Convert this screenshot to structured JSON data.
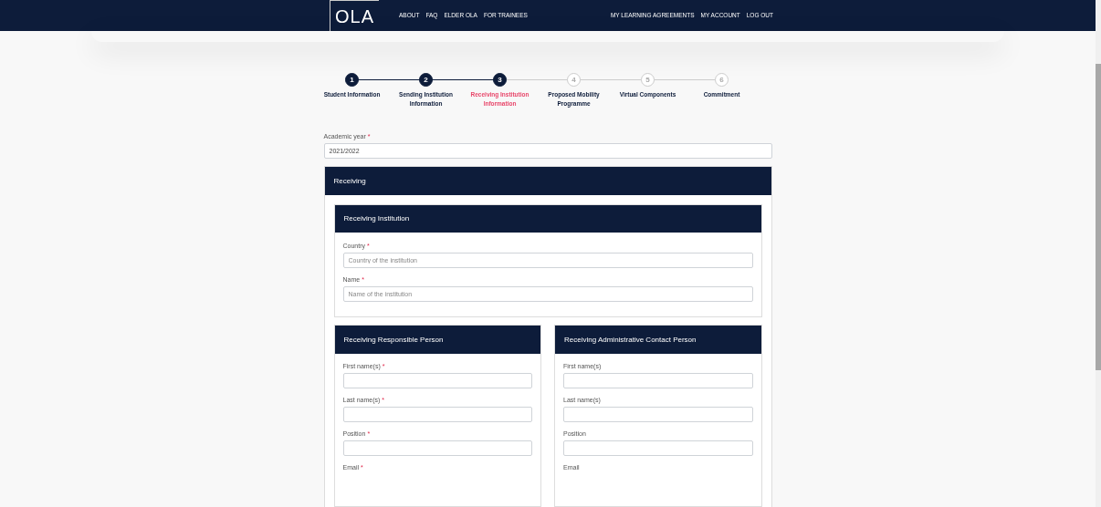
{
  "header": {
    "logo": "OLA",
    "nav_left": [
      "ABOUT",
      "FAQ",
      "ELDER OLA",
      "FOR TRAINEES"
    ],
    "nav_right": [
      "MY LEARNING AGREEMENTS",
      "MY ACCOUNT",
      "LOG OUT"
    ]
  },
  "stepper": [
    {
      "number": "1",
      "label": "Student Information",
      "reached": true,
      "selected": false
    },
    {
      "number": "2",
      "label": "Sending Institution Information",
      "reached": true,
      "selected": false
    },
    {
      "number": "3",
      "label": "Receiving Institution Information",
      "reached": true,
      "selected": true
    },
    {
      "number": "4",
      "label": "Proposed Mobility Programme",
      "reached": false,
      "selected": false
    },
    {
      "number": "5",
      "label": "Virtual Components",
      "reached": false,
      "selected": false
    },
    {
      "number": "6",
      "label": "Commitment",
      "reached": false,
      "selected": false
    }
  ],
  "academic_year": {
    "label": "Academic year",
    "required_mark": "*",
    "value": "2021/2022"
  },
  "receiving": {
    "title": "Receiving",
    "institution": {
      "title": "Receiving Institution",
      "fields": [
        {
          "label": "Country",
          "required_mark": "*",
          "placeholder": "Country of the institution"
        },
        {
          "label": "Name",
          "required_mark": "*",
          "placeholder": "Name of the institution"
        }
      ]
    },
    "persons": [
      {
        "title": "Receiving Responsible Person",
        "fields": [
          {
            "label": "First name(s)",
            "required_mark": "*"
          },
          {
            "label": "Last name(s)",
            "required_mark": "*"
          },
          {
            "label": "Position",
            "required_mark": "*"
          },
          {
            "label": "Email",
            "required_mark": "*"
          }
        ]
      },
      {
        "title": "Receiving Administrative Contact Person",
        "fields": [
          {
            "label": "First name(s)"
          },
          {
            "label": "Last name(s)"
          },
          {
            "label": "Position"
          },
          {
            "label": "Email"
          }
        ]
      }
    ]
  }
}
